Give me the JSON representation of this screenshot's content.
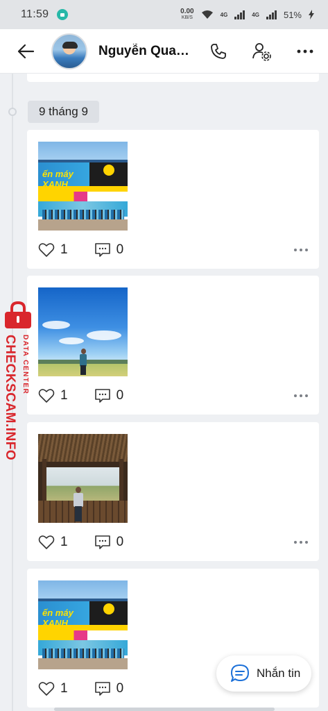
{
  "status_bar": {
    "time": "11:59",
    "net_speed_value": "0.00",
    "net_speed_unit": "KB/S",
    "signal_1": "4G",
    "signal_2": "4G",
    "battery": "51%"
  },
  "header": {
    "contact_name": "Nguyễn Qua…",
    "back_icon": "back-arrow-icon",
    "call_icon": "phone-icon",
    "settings_icon": "user-settings-icon",
    "more_icon": "more-icon"
  },
  "timeline": {
    "date_label": "9 tháng 9"
  },
  "posts": [
    {
      "photo": "store-photo",
      "likes": "1",
      "comments": "0"
    },
    {
      "photo": "field-photo",
      "likes": "1",
      "comments": "0"
    },
    {
      "photo": "hut-photo",
      "likes": "1",
      "comments": "0"
    },
    {
      "photo": "store-photo",
      "likes": "1",
      "comments": "0"
    }
  ],
  "fab": {
    "label": "Nhắn tin",
    "icon": "chat-bubble-icon"
  },
  "watermark": {
    "main": "CHECKSCAM.INFO",
    "sub": "DATA CENTER"
  },
  "colors": {
    "accent_blue": "#1a6fd8",
    "watermark_red": "#d9262c",
    "background": "#eef0f3"
  }
}
